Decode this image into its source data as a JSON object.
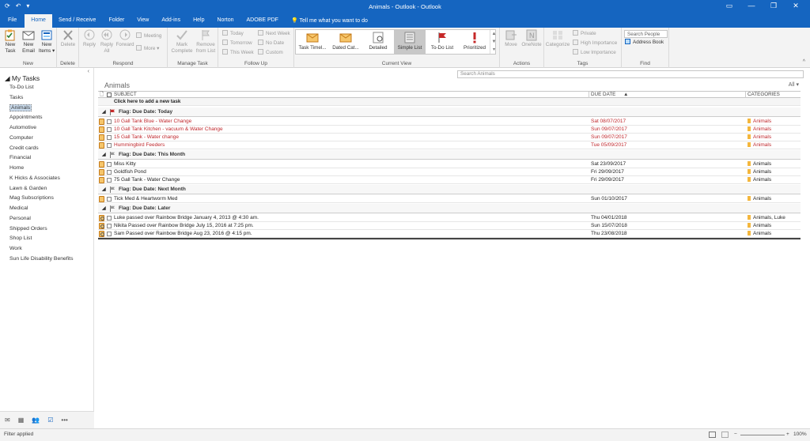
{
  "window": {
    "title": "Animals - Outlook - Outlook",
    "qat_undo": "↶",
    "qat_more": "▾",
    "min": "▭",
    "minimize": "—",
    "restore": "❐",
    "close": "✕"
  },
  "tabs": [
    "File",
    "Home",
    "Send / Receive",
    "Folder",
    "View",
    "Add-ins",
    "Help",
    "Norton",
    "ADOBE PDF"
  ],
  "tell_me": "Tell me what you want to do",
  "ribbon": {
    "new_task": [
      "New",
      "Task"
    ],
    "new_email": [
      "New",
      "Email"
    ],
    "new_items": [
      "New",
      "Items ▾"
    ],
    "group_new": "New",
    "delete": "Delete",
    "group_delete": "Delete",
    "reply": "Reply",
    "reply_all": [
      "Reply",
      "All"
    ],
    "forward": "Forward",
    "meeting": "Meeting",
    "more": "More ▾",
    "group_respond": "Respond",
    "mark_complete": [
      "Mark",
      "Complete"
    ],
    "remove_from_list": [
      "Remove",
      "from List"
    ],
    "group_manage": "Manage Task",
    "today": "Today",
    "tomorrow": "Tomorrow",
    "this_week": "This Week",
    "next_week": "Next Week",
    "no_date": "No Date",
    "custom": "Custom",
    "group_follow": "Follow Up",
    "views": [
      "Task Timel...",
      "Dated Cat...",
      "Detailed",
      "Simple List",
      "To-Do List",
      "Prioritized"
    ],
    "group_view": "Current View",
    "move": "Move",
    "onenote": "OneNote",
    "group_actions": "Actions",
    "categorize": "Categorize",
    "private": "Private",
    "high_importance": "High Importance",
    "low_importance": "Low Importance",
    "group_tags": "Tags",
    "search_people": "Search People",
    "address_book": "Address Book",
    "group_find": "Find"
  },
  "sidebar": {
    "header": "◢ My Tasks",
    "collapse": "‹",
    "items": [
      "To-Do List",
      "Tasks",
      "Animals",
      "Appointments",
      "Automotive",
      "Computer",
      "Credit cards",
      "Financial",
      "Home",
      "K Hicks & Associates",
      "Lawn & Garden",
      "Mag Subscriptions",
      "Medical",
      "Personal",
      "Shipped Orders",
      "Shop List",
      "Work",
      "Sun Life Disability Benefits"
    ],
    "selected": "Animals"
  },
  "navbar": {
    "mail": "✉",
    "calendar": "▦",
    "people": "👥",
    "tasks": "☑",
    "more": "•••"
  },
  "main": {
    "search_placeholder": "Search Animals",
    "folder_title": "Animals",
    "filter": "All ▾",
    "col_subject": "SUBJECT",
    "col_due": "DUE DATE",
    "col_categories": "CATEGORIES",
    "add_task": "Click here to add a new task",
    "groups": [
      {
        "label": "Flag: Due Date: Today",
        "rows": [
          {
            "subject": "10 Gall Tank Blue - Water Change",
            "due": "Sat 08/07/2017",
            "cat": "Animals",
            "overdue": true,
            "recur": false
          },
          {
            "subject": "10 Gall Tank Kitchen - vacuum & Water Change",
            "due": "Sun 09/07/2017",
            "cat": "Animals",
            "overdue": true,
            "recur": false
          },
          {
            "subject": "15 Gall Tank - Water change",
            "due": "Sun 09/07/2017",
            "cat": "Animals",
            "overdue": true,
            "recur": false
          },
          {
            "subject": "Hummingbird Feeders",
            "due": "Tue 05/09/2017",
            "cat": "Animals",
            "overdue": true,
            "recur": false
          }
        ]
      },
      {
        "label": "Flag: Due Date: This Month",
        "rows": [
          {
            "subject": "Miss Kitty",
            "due": "Sat 23/09/2017",
            "cat": "Animals",
            "overdue": false,
            "recur": false
          },
          {
            "subject": "Goldfish Pond",
            "due": "Fri 29/09/2017",
            "cat": "Animals",
            "overdue": false,
            "recur": false
          },
          {
            "subject": "75 Gall Tank - Water Change",
            "due": "Fri 29/09/2017",
            "cat": "Animals",
            "overdue": false,
            "recur": false
          }
        ]
      },
      {
        "label": "Flag: Due Date: Next Month",
        "rows": [
          {
            "subject": "Tick Med & Heartworm Med",
            "due": "Sun 01/10/2017",
            "cat": "Animals",
            "overdue": false,
            "recur": false
          }
        ]
      },
      {
        "label": "Flag: Due Date: Later",
        "rows": [
          {
            "subject": "Luke passed over Rainbow Bridge January 4, 2013 @ 4:30 am.",
            "due": "Thu 04/01/2018",
            "cat": "Animals, Luke",
            "overdue": false,
            "recur": true
          },
          {
            "subject": "Nikita Passed over Rainbow Bridge July 15, 2016 at 7:25 pm.",
            "due": "Sun 15/07/2018",
            "cat": "Animals",
            "overdue": false,
            "recur": true
          },
          {
            "subject": "Sam Passed over Rainbow Bridge Aug 23, 2016 @ 4:15 pm.",
            "due": "Thu 23/08/2018",
            "cat": "Animals",
            "overdue": false,
            "recur": true
          }
        ]
      }
    ]
  },
  "status": {
    "left": "Filter applied",
    "zoom": "100%",
    "minus": "−",
    "plus": "+"
  }
}
